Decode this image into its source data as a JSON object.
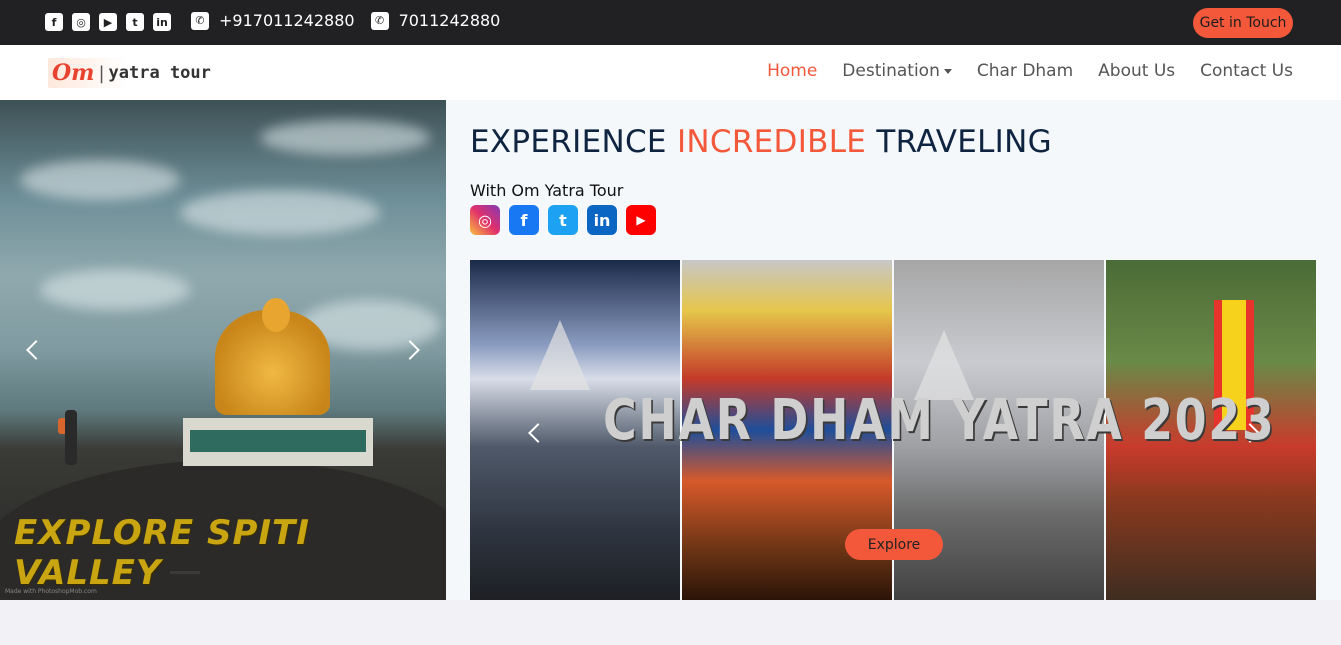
{
  "topbar": {
    "social_icons": [
      {
        "name": "facebook-icon",
        "glyph": "f"
      },
      {
        "name": "instagram-icon",
        "glyph": "◎"
      },
      {
        "name": "youtube-icon",
        "glyph": "▶"
      },
      {
        "name": "twitter-icon",
        "glyph": "t"
      },
      {
        "name": "linkedin-icon",
        "glyph": "in"
      }
    ],
    "phone_icon": "phone-icon",
    "phone": "+917011242880",
    "whatsapp_icon": "whatsapp-icon",
    "whatsapp": "7011242880",
    "cta_label": "Get in Touch"
  },
  "logo": {
    "om": "Om",
    "rest": "yatra tour"
  },
  "nav": {
    "home": "Home",
    "destination": "Destination",
    "char_dham": "Char Dham",
    "about": "About Us",
    "contact": "Contact Us"
  },
  "hero_left": {
    "caption": "EXPLORE SPITI VALLEY",
    "credit": "Made with PhotoshopMob.com"
  },
  "right": {
    "headline_part1": "EXPERIENCE",
    "headline_accent": "INCREDIBLE",
    "headline_part2": "TRAVELING",
    "with_text": "With Om Yatra Tour",
    "social": [
      {
        "name": "instagram-icon",
        "glyph": "◎"
      },
      {
        "name": "facebook-icon",
        "glyph": "f"
      },
      {
        "name": "twitter-icon",
        "glyph": "t"
      },
      {
        "name": "linkedin-icon",
        "glyph": "in"
      },
      {
        "name": "youtube-icon",
        "glyph": "▶"
      }
    ],
    "banner_title": "CHAR DHAM YATRA 2023",
    "explore_label": "Explore"
  },
  "colors": {
    "accent": "#f4583b",
    "topbar": "#212124",
    "headline": "#0f2440"
  }
}
